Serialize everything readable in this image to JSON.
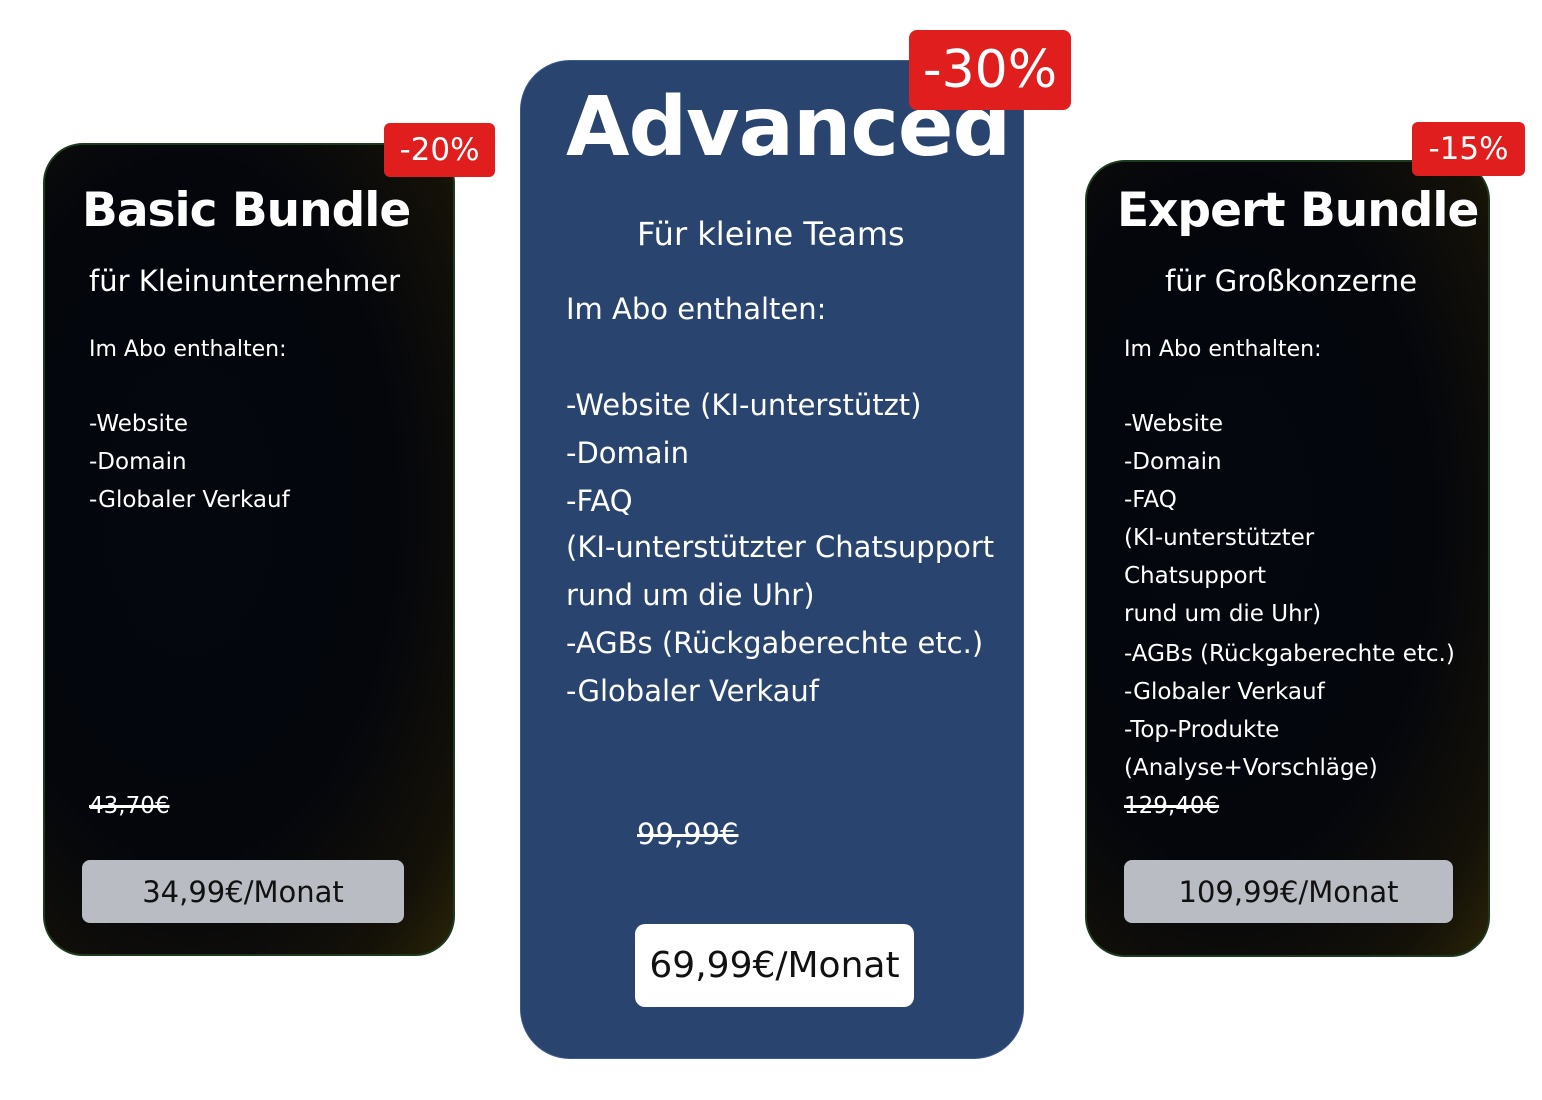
{
  "colors": {
    "dark_card_bg": "#04060c",
    "advanced_card_bg": "#2a4470",
    "badge_red": "#e01e1e",
    "price_button_grey": "#b9bcc3",
    "price_button_white": "#ffffff"
  },
  "plans": {
    "basic": {
      "discount": "-20%",
      "title": "Basic Bundle",
      "subtitle": "für Kleinunternehmer",
      "included_heading": "Im Abo enthalten:",
      "features": [
        "-Website",
        "-Domain",
        "-Globaler Verkauf"
      ],
      "old_price": "43,70€",
      "price_label": "34,99€/Monat"
    },
    "advanced": {
      "discount": "-30%",
      "title": "Advanced",
      "subtitle": "Für kleine Teams",
      "included_heading": "Im Abo enthalten:",
      "features": [
        "-Website (KI-unterstützt)",
        "-Domain",
        "-FAQ",
        "(KI-unterstützter Chatsupport",
        "rund um die Uhr)",
        "-AGBs (Rückgaberechte etc.)",
        "-Globaler Verkauf"
      ],
      "old_price": "99,99€",
      "price_label": "69,99€/Monat"
    },
    "expert": {
      "discount": "-15%",
      "title": "Expert Bundle",
      "subtitle": "für Großkonzerne",
      "included_heading": "Im Abo enthalten:",
      "features": [
        "-Website",
        "-Domain",
        "-FAQ",
        "(KI-unterstützter",
        "Chatsupport",
        "rund um die Uhr)",
        "-AGBs (Rückgaberechte etc.)",
        "-Globaler Verkauf",
        "-Top-Produkte",
        "(Analyse+Vorschläge)"
      ],
      "old_price": "129,40€",
      "price_label": "109,99€/Monat"
    }
  }
}
